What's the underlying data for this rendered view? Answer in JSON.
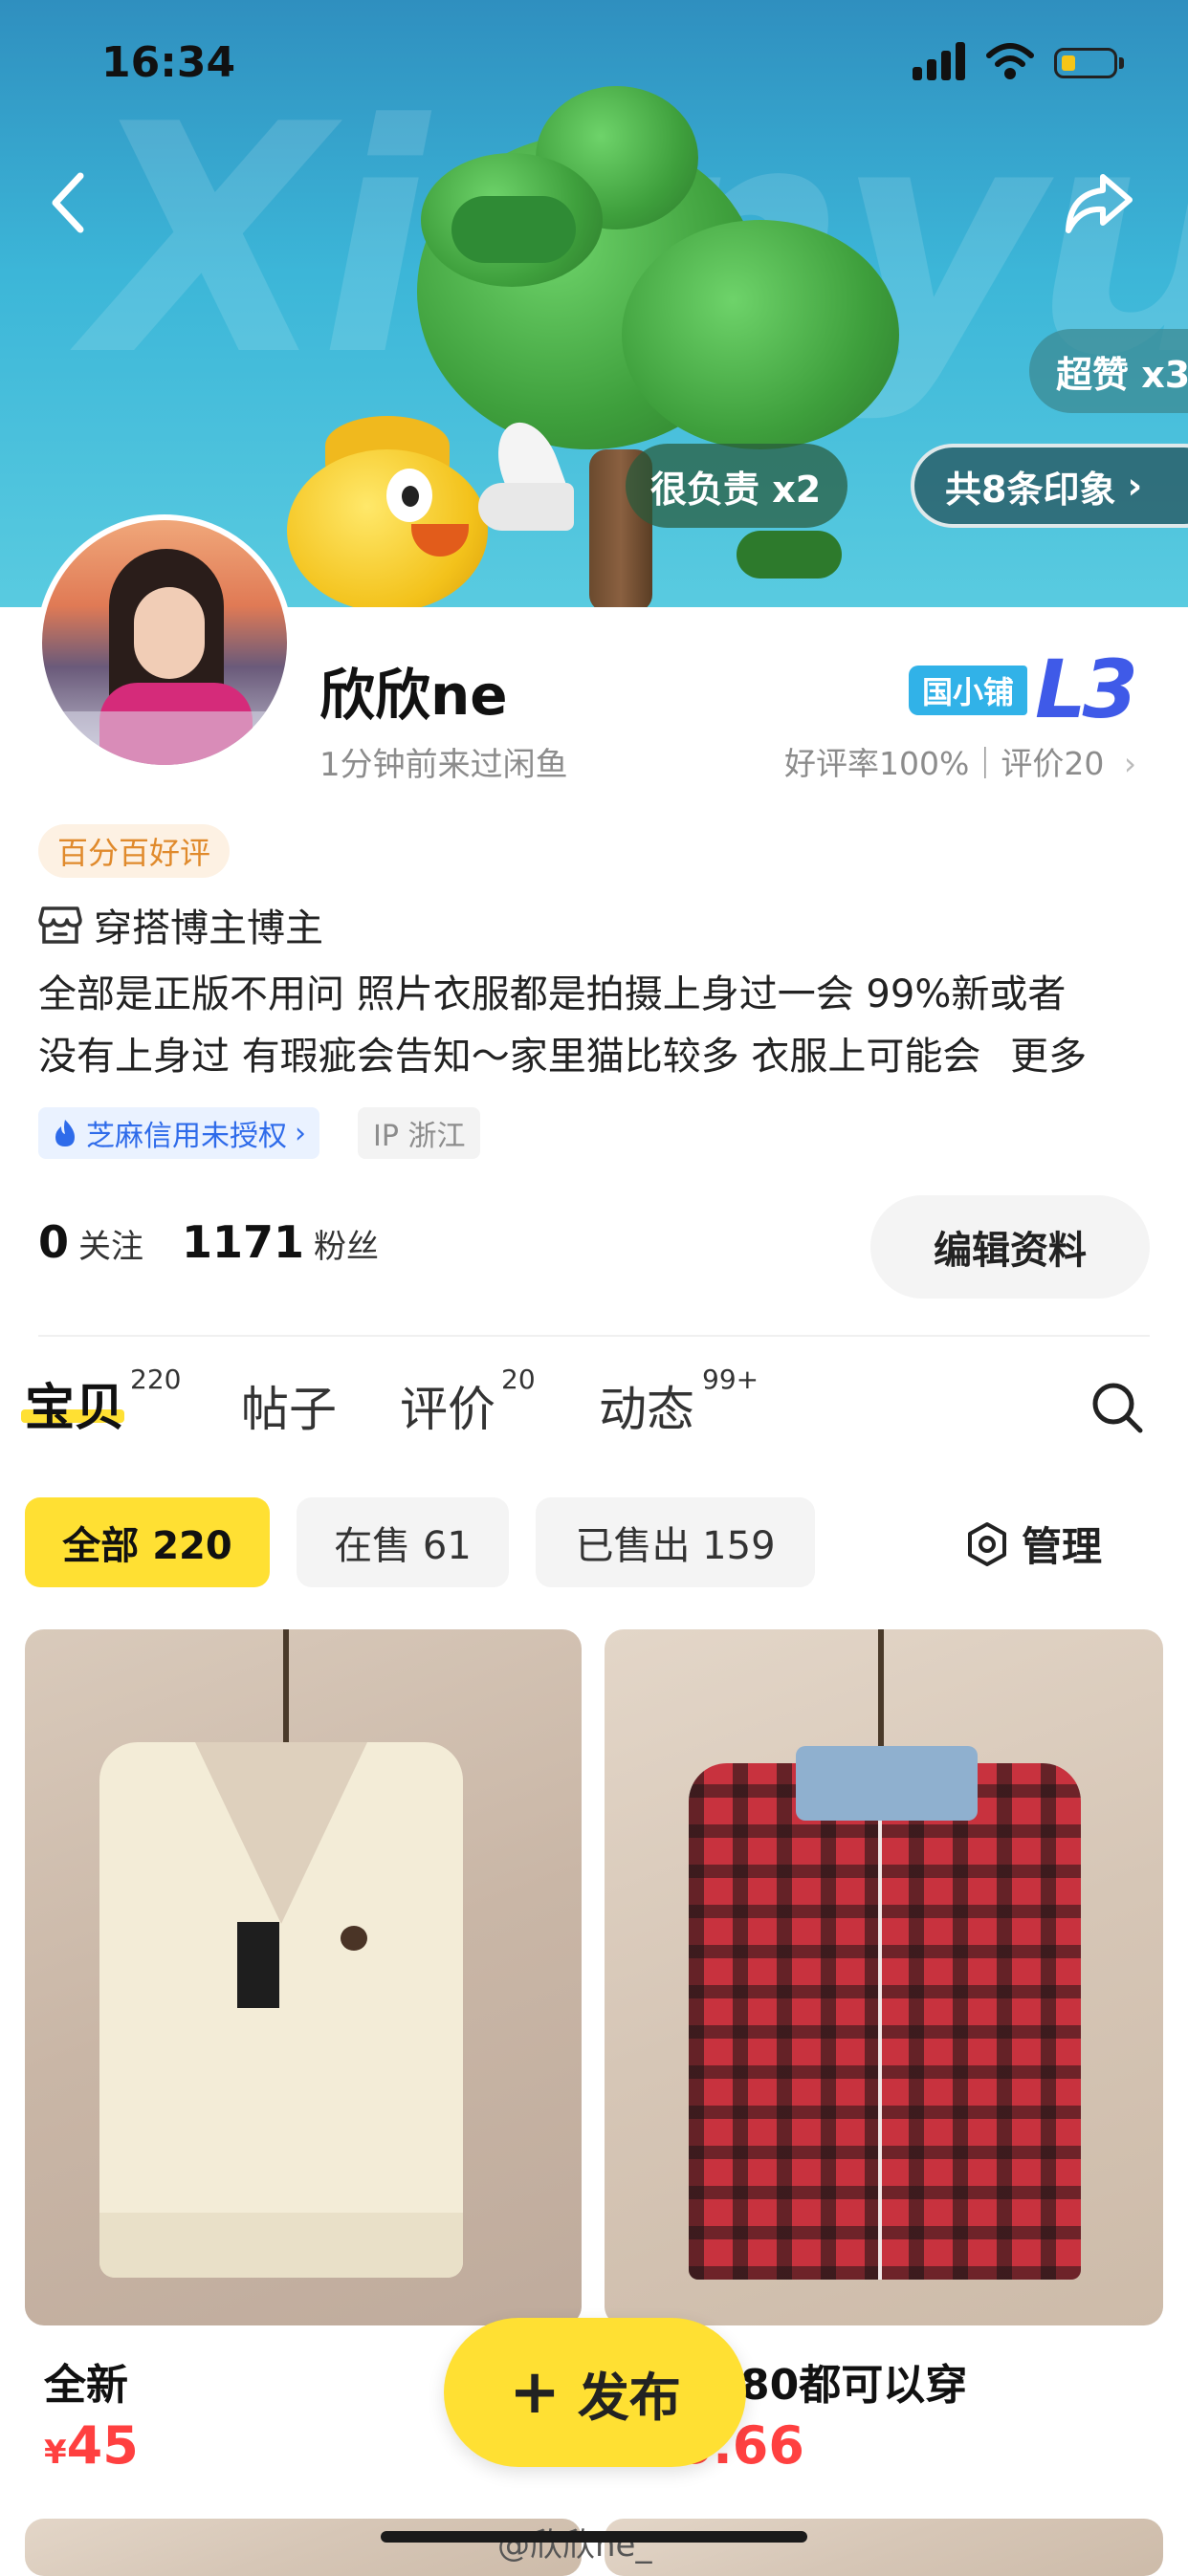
{
  "status_bar": {
    "time": "16:34"
  },
  "hero": {
    "watermark": "Xianyu",
    "chips": {
      "super_like": "超赞 x3",
      "responsible": "很负责 x2",
      "impressions": "共8条印象"
    }
  },
  "profile": {
    "name": "欣欣ne",
    "last_seen": "1分钟前来过闲鱼",
    "shop_badge": "国小铺",
    "level": "L3",
    "rating": "好评率100%｜评价20",
    "good_tag": "百分百好评",
    "role": "穿搭博主博主",
    "bio_line1": "全部是正版不用问 照片衣服都是拍摄上身过一会 99%新或者",
    "bio_line2": "没有上身过 有瑕疵会告知～家里猫比较多 衣服上可能会",
    "bio_more": "更多",
    "credit_tag": "芝麻信用未授权",
    "ip_tag": "IP 浙江"
  },
  "stats": {
    "following_count": "0",
    "following_label": "关注",
    "fans_count": "1171",
    "fans_label": "粉丝",
    "edit_button": "编辑资料"
  },
  "tabs": [
    {
      "label": "宝贝",
      "count": "220"
    },
    {
      "label": "帖子",
      "count": ""
    },
    {
      "label": "评价",
      "count": "20"
    },
    {
      "label": "动态",
      "count": "99+"
    }
  ],
  "filters": {
    "all": "全部 220",
    "on_sale": "在售 61",
    "sold": "已售出 159",
    "manage": "管理"
  },
  "products": [
    {
      "title": "全新",
      "price_symbol": "¥",
      "price": "45"
    },
    {
      "title": "80都可以穿",
      "price_symbol": "¥",
      "price": "5.66"
    }
  ],
  "publish_button": "发布",
  "watermark_user": "@欣欣ne_"
}
